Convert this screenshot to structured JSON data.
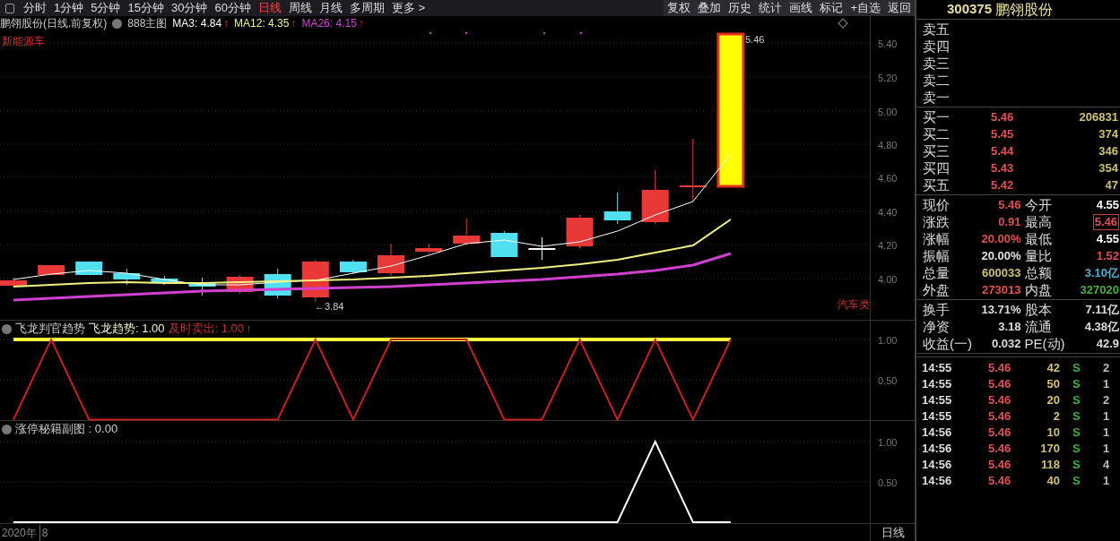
{
  "toolbar": {
    "periods": [
      {
        "label": "分时",
        "selected": false
      },
      {
        "label": "1分钟",
        "selected": false
      },
      {
        "label": "5分钟",
        "selected": false
      },
      {
        "label": "15分钟",
        "selected": false
      },
      {
        "label": "30分钟",
        "selected": false
      },
      {
        "label": "60分钟",
        "selected": false
      },
      {
        "label": "日线",
        "selected": true
      },
      {
        "label": "周线",
        "selected": false
      },
      {
        "label": "月线",
        "selected": false
      },
      {
        "label": "多周期",
        "selected": false
      },
      {
        "label": "更多 >",
        "selected": false
      }
    ],
    "tools": [
      "复权",
      "叠加",
      "历史",
      "统计",
      "画线",
      "标记",
      "+自选",
      "返回"
    ]
  },
  "main_chart": {
    "title": "鹏翎股份(日线.前复权)",
    "template": "888主图",
    "indicators": [
      {
        "label": "MA3: 4.84",
        "arrow": "↑",
        "color": "#ffffff"
      },
      {
        "label": "MA12: 4.35",
        "arrow": "↑",
        "color": "#f0f080"
      },
      {
        "label": "MA26: 4.15",
        "arrow": "↑",
        "color": "#d040d0"
      }
    ],
    "sector": "新能源车",
    "industry": "汽车类",
    "low_mark": "←3.84",
    "high_mark": "5.46",
    "y_axis": [
      "5.40",
      "5.20",
      "5.00",
      "4.80",
      "4.60",
      "4.40",
      "4.20",
      "4.00"
    ]
  },
  "panels": [
    {
      "title": "飞龙判官趋势",
      "legend": [
        {
          "label": "飞龙趋势: 1.00",
          "color": "#f0f0c0"
        },
        {
          "label": "及时卖出: 1.00",
          "arrow": "↑",
          "color": "#c03030"
        }
      ],
      "y_axis": [
        "1.00",
        "0.50"
      ]
    },
    {
      "title": "涨停秘籍副图 : 0.00",
      "y_axis": [
        "1.00",
        "0.50"
      ]
    }
  ],
  "time_axis": {
    "year": "2020年",
    "month": "8",
    "period": "日线"
  },
  "quote": {
    "code": "300375",
    "name": "鹏翎股份",
    "asks": [
      {
        "label": "卖五"
      },
      {
        "label": "卖四"
      },
      {
        "label": "卖三"
      },
      {
        "label": "卖二"
      },
      {
        "label": "卖一"
      }
    ],
    "bids": [
      {
        "label": "买一",
        "price": "5.46",
        "volume": "206831"
      },
      {
        "label": "买二",
        "price": "5.45",
        "volume": "374"
      },
      {
        "label": "买三",
        "price": "5.44",
        "volume": "346"
      },
      {
        "label": "买四",
        "price": "5.43",
        "volume": "354"
      },
      {
        "label": "买五",
        "price": "5.42",
        "volume": "47"
      }
    ],
    "stats": [
      {
        "label": "现价",
        "value": "5.46",
        "color": "#e05050",
        "boxed": false
      },
      {
        "label": "今开",
        "value": "4.55",
        "color": "#ffffff",
        "boxed": false
      },
      {
        "label": "涨跌",
        "value": "0.91",
        "color": "#e05050",
        "boxed": false
      },
      {
        "label": "最高",
        "value": "5.46",
        "color": "#e05050",
        "boxed": true
      },
      {
        "label": "涨幅",
        "value": "20.00%",
        "color": "#e05050",
        "boxed": false
      },
      {
        "label": "最低",
        "value": "4.55",
        "color": "#ffffff",
        "boxed": false
      },
      {
        "label": "振幅",
        "value": "20.00%",
        "color": "#e0e0e0",
        "boxed": false
      },
      {
        "label": "量比",
        "value": "1.52",
        "color": "#e05050",
        "boxed": false
      },
      {
        "label": "总量",
        "value": "600033",
        "color": "#d0c070",
        "boxed": false
      },
      {
        "label": "总额",
        "value": "3.10亿",
        "color": "#50b0d0",
        "boxed": false
      },
      {
        "label": "外盘",
        "value": "273013",
        "color": "#e05050",
        "boxed": false
      },
      {
        "label": "内盘",
        "value": "327020",
        "color": "#40b040",
        "boxed": false
      }
    ],
    "finance": [
      {
        "label": "换手",
        "value": "13.71%"
      },
      {
        "label": "股本",
        "value": "7.11亿"
      },
      {
        "label": "净资",
        "value": "3.18"
      },
      {
        "label": "流通",
        "value": "4.38亿"
      },
      {
        "label": "收益(一)",
        "value": "0.032"
      },
      {
        "label": "PE(动)",
        "value": "42.9"
      }
    ],
    "ticks": [
      {
        "time": "14:55",
        "price": "5.46",
        "volume": "42",
        "side": "S",
        "count": "2"
      },
      {
        "time": "14:55",
        "price": "5.46",
        "volume": "50",
        "side": "S",
        "count": "1"
      },
      {
        "time": "14:55",
        "price": "5.46",
        "volume": "20",
        "side": "S",
        "count": "2"
      },
      {
        "time": "14:55",
        "price": "5.46",
        "volume": "2",
        "side": "S",
        "count": "1"
      },
      {
        "time": "14:56",
        "price": "5.46",
        "volume": "10",
        "side": "S",
        "count": "1"
      },
      {
        "time": "14:56",
        "price": "5.46",
        "volume": "170",
        "side": "S",
        "count": "1"
      },
      {
        "time": "14:56",
        "price": "5.46",
        "volume": "118",
        "side": "S",
        "count": "4"
      },
      {
        "time": "14:56",
        "price": "5.46",
        "volume": "40",
        "side": "S",
        "count": "1"
      }
    ]
  }
}
